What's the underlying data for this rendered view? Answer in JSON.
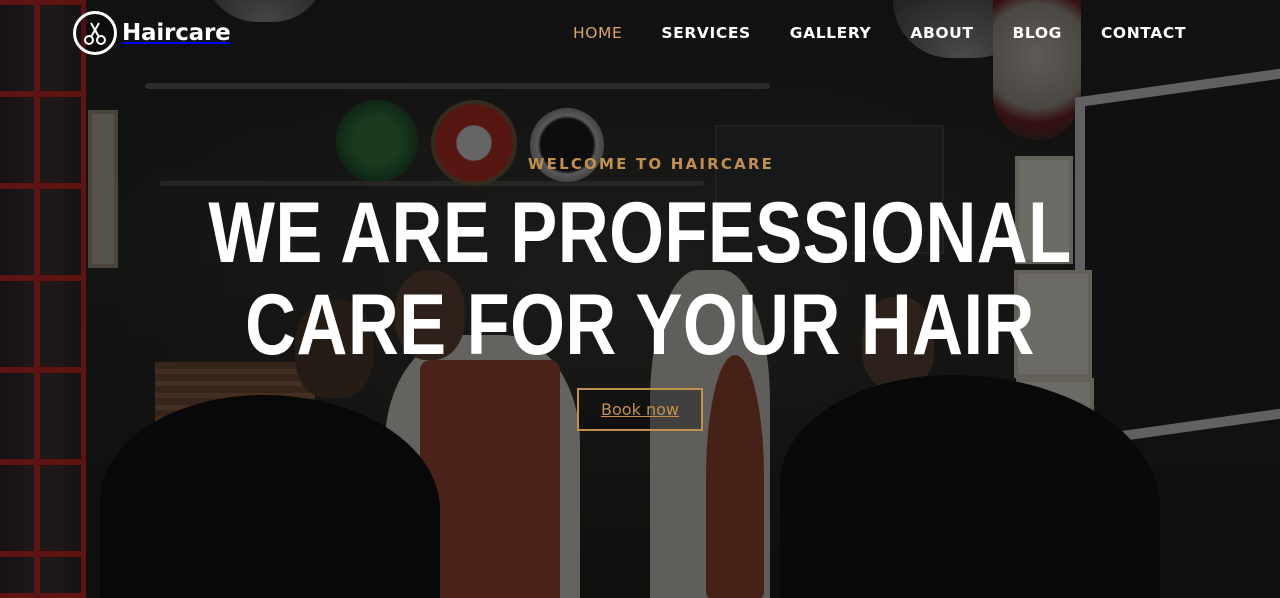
{
  "brand": {
    "name": "Haircare",
    "logo_icon": "scissors-icon"
  },
  "nav": {
    "items": [
      {
        "label": "HOME",
        "active": true
      },
      {
        "label": "SERVICES",
        "active": false
      },
      {
        "label": "GALLERY",
        "active": false
      },
      {
        "label": "ABOUT",
        "active": false
      },
      {
        "label": "BLOG",
        "active": false
      },
      {
        "label": "CONTACT",
        "active": false
      }
    ]
  },
  "hero": {
    "eyebrow": "WELCOME TO HAIRCARE",
    "headline": "WE ARE PROFESSIONAL CARE FOR YOUR HAIR",
    "cta_label": "Book now"
  },
  "colors": {
    "accent": "#c1904f",
    "nav_active": "#d7a467",
    "text": "#ffffff"
  }
}
